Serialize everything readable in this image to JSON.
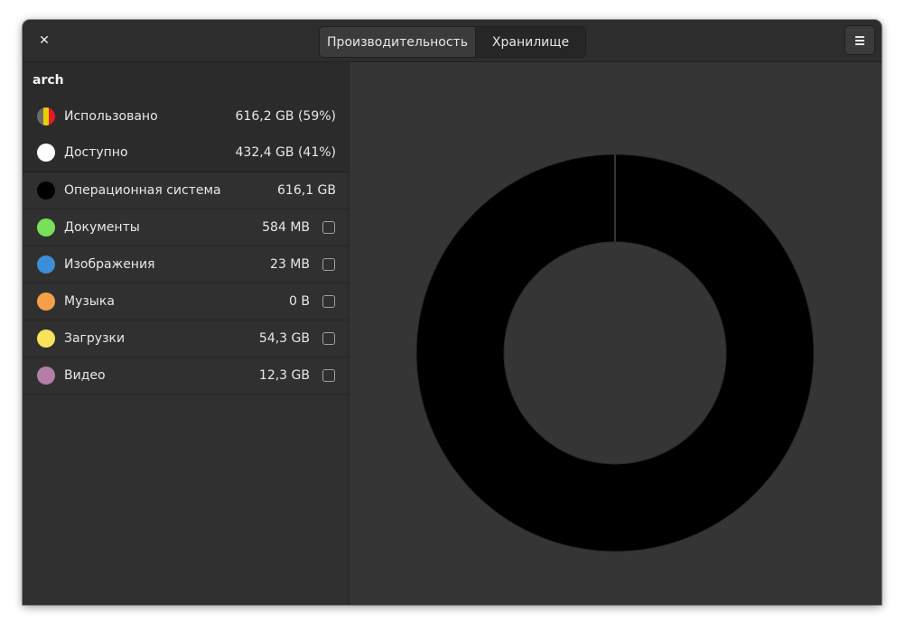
{
  "header": {
    "close_label": "✕",
    "tabs": [
      {
        "label": "Производительность",
        "active": false
      },
      {
        "label": "Хранилище",
        "active": true
      }
    ],
    "menu_icon": "hamburger-menu-icon"
  },
  "device": {
    "name": "arch",
    "used": {
      "label": "Использовано",
      "value": "616,2 GB (59%)"
    },
    "available": {
      "label": "Доступно",
      "value": "432,4 GB (41%)"
    }
  },
  "categories": [
    {
      "label": "Операционная система",
      "value": "616,1 GB",
      "color": "#000000",
      "checkbox": false
    },
    {
      "label": "Документы",
      "value": "584 MB",
      "color": "#78e05a",
      "checkbox": true
    },
    {
      "label": "Изображения",
      "value": "23 MB",
      "color": "#3a8fd8",
      "checkbox": true
    },
    {
      "label": "Музыка",
      "value": "0 B",
      "color": "#f4a04a",
      "checkbox": true
    },
    {
      "label": "Загрузки",
      "value": "54,3 GB",
      "color": "#f8e45a",
      "checkbox": true
    },
    {
      "label": "Видео",
      "value": "12,3 GB",
      "color": "#b47ea8",
      "checkbox": true
    }
  ],
  "colors": {
    "used_icon": [
      "#6b6b6b",
      "#e8d000",
      "#e01b24"
    ],
    "available_icon": "#ffffff",
    "ring": "#000000"
  }
}
